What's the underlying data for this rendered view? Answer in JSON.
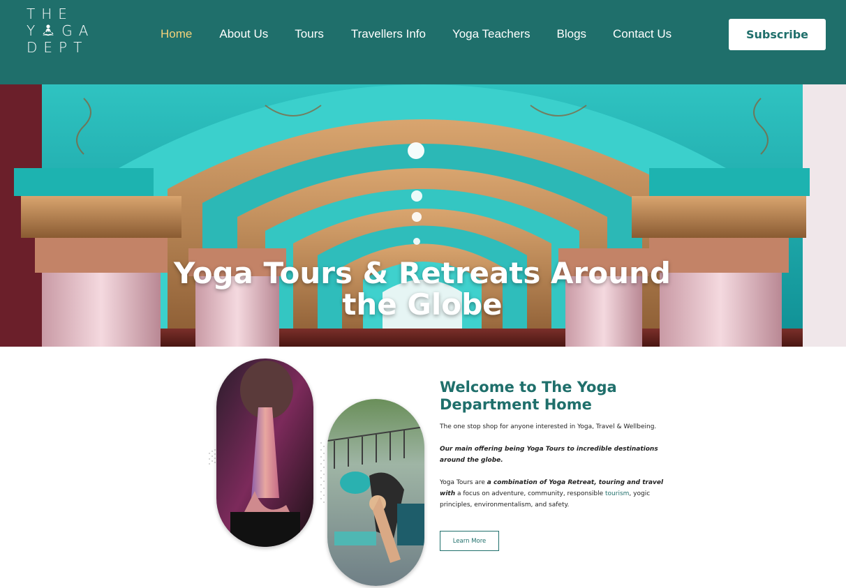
{
  "header": {
    "logo": {
      "line1": "THE",
      "line2_left": "Y",
      "line2_right": "GA",
      "line3": "DEPT"
    },
    "nav": [
      {
        "label": "Home",
        "active": true
      },
      {
        "label": "About Us"
      },
      {
        "label": "Tours"
      },
      {
        "label": "Travellers Info"
      },
      {
        "label": "Yoga Teachers"
      },
      {
        "label": "Blogs"
      },
      {
        "label": "Contact Us"
      }
    ],
    "subscribe_label": "Subscribe"
  },
  "hero": {
    "title_line1": "Yoga Tours & Retreats Around",
    "title_line2": "the Globe"
  },
  "welcome": {
    "title": "Welcome to The Yoga Department Home",
    "p1": "The one stop shop for anyone interested in Yoga, Travel & Wellbeing.",
    "p2": "Our main offering being Yoga Tours to incredible destinations around the globe.",
    "p3_a": "Yoga Tours are ",
    "p3_b": "a combination of Yoga Retreat, touring and travel with",
    "p3_c": " a focus on adventure, community, responsible ",
    "p3_link": "tourism",
    "p3_d": ", yogic principles, environmentalism, and safety.",
    "learn_more_label": "Learn More"
  },
  "colors": {
    "brand_teal": "#1f6f6b",
    "nav_active": "#f4d27a",
    "white": "#ffffff"
  }
}
